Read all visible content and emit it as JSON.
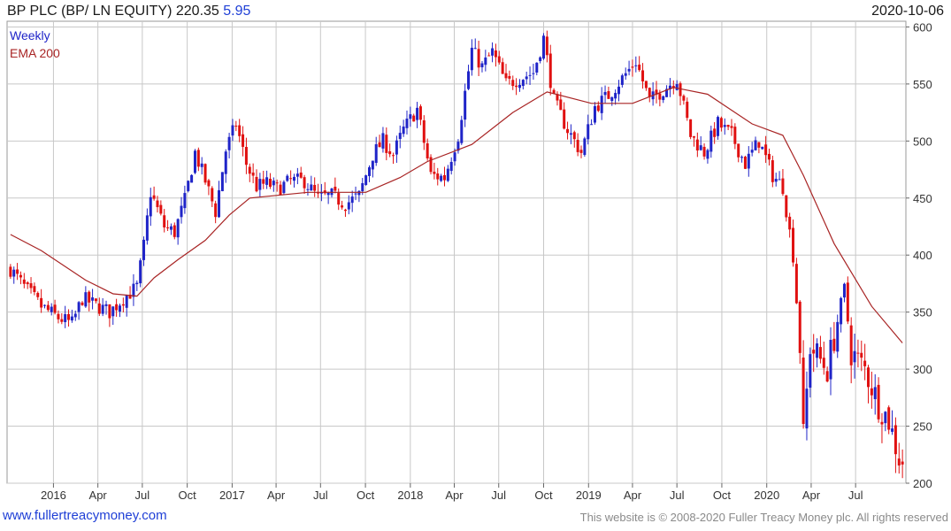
{
  "header": {
    "title": "BP PLC (BP/ LN EQUITY) 220.35",
    "change": "5.95",
    "date": "2020-10-06"
  },
  "footer": {
    "link": "www.fullertreacymoney.com",
    "copyright": "This website is © 2008-2020 Fuller Treacy Money plc. All rights reserved"
  },
  "colors": {
    "up": "#1f24c8",
    "down": "#e01010",
    "ema": "#a82424",
    "grid": "#c8c8c8"
  },
  "chart_data": {
    "type": "candlestick",
    "period": "Weekly",
    "legend": [
      {
        "label": "Weekly",
        "color": "#1f24c8"
      },
      {
        "label": "EMA 200",
        "color": "#a82424"
      }
    ],
    "ylim": [
      200,
      605
    ],
    "y_ticks": [
      200,
      250,
      300,
      350,
      400,
      450,
      500,
      550,
      600
    ],
    "x_ticks": [
      {
        "label": "2016",
        "date": "2016-01-01"
      },
      {
        "label": "Apr",
        "date": "2016-04-01"
      },
      {
        "label": "Jul",
        "date": "2016-07-01"
      },
      {
        "label": "Oct",
        "date": "2016-10-01"
      },
      {
        "label": "2017",
        "date": "2017-01-01"
      },
      {
        "label": "Apr",
        "date": "2017-04-01"
      },
      {
        "label": "Jul",
        "date": "2017-07-01"
      },
      {
        "label": "Oct",
        "date": "2017-10-01"
      },
      {
        "label": "2018",
        "date": "2018-01-01"
      },
      {
        "label": "Apr",
        "date": "2018-04-01"
      },
      {
        "label": "Jul",
        "date": "2018-07-01"
      },
      {
        "label": "Oct",
        "date": "2018-10-01"
      },
      {
        "label": "2019",
        "date": "2019-01-01"
      },
      {
        "label": "Apr",
        "date": "2019-04-01"
      },
      {
        "label": "Jul",
        "date": "2019-07-01"
      },
      {
        "label": "Oct",
        "date": "2019-10-01"
      },
      {
        "label": "2020",
        "date": "2020-01-01"
      },
      {
        "label": "Apr",
        "date": "2020-04-01"
      },
      {
        "label": "Jul",
        "date": "2020-07-01"
      }
    ],
    "x_range": [
      "2015-09-28",
      "2020-10-12"
    ],
    "grid": true,
    "price_path": [
      [
        "2015-10-05",
        388
      ],
      [
        "2015-11-02",
        372
      ],
      [
        "2015-12-07",
        355
      ],
      [
        "2016-01-11",
        345
      ],
      [
        "2016-02-08",
        340
      ],
      [
        "2016-02-29",
        362
      ],
      [
        "2016-03-28",
        356
      ],
      [
        "2016-04-25",
        350
      ],
      [
        "2016-05-23",
        362
      ],
      [
        "2016-06-20",
        372
      ],
      [
        "2016-07-04",
        408
      ],
      [
        "2016-07-18",
        455
      ],
      [
        "2016-08-15",
        425
      ],
      [
        "2016-09-05",
        420
      ],
      [
        "2016-09-26",
        448
      ],
      [
        "2016-10-17",
        490
      ],
      [
        "2016-11-07",
        465
      ],
      [
        "2016-11-28",
        438
      ],
      [
        "2016-12-19",
        492
      ],
      [
        "2017-01-09",
        515
      ],
      [
        "2017-01-30",
        480
      ],
      [
        "2017-02-20",
        460
      ],
      [
        "2017-03-13",
        463
      ],
      [
        "2017-04-03",
        458
      ],
      [
        "2017-05-01",
        465
      ],
      [
        "2017-05-29",
        465
      ],
      [
        "2017-06-26",
        450
      ],
      [
        "2017-07-24",
        452
      ],
      [
        "2017-08-21",
        445
      ],
      [
        "2017-09-18",
        452
      ],
      [
        "2017-10-16",
        488
      ],
      [
        "2017-11-06",
        500
      ],
      [
        "2017-11-27",
        488
      ],
      [
        "2017-12-18",
        510
      ],
      [
        "2018-01-15",
        528
      ],
      [
        "2018-02-12",
        470
      ],
      [
        "2018-03-12",
        468
      ],
      [
        "2018-04-09",
        505
      ],
      [
        "2018-05-07",
        580
      ],
      [
        "2018-05-28",
        565
      ],
      [
        "2018-06-18",
        578
      ],
      [
        "2018-07-16",
        550
      ],
      [
        "2018-08-13",
        555
      ],
      [
        "2018-09-10",
        560
      ],
      [
        "2018-10-01",
        590
      ],
      [
        "2018-10-22",
        535
      ],
      [
        "2018-11-19",
        510
      ],
      [
        "2018-12-17",
        490
      ],
      [
        "2019-01-14",
        530
      ],
      [
        "2019-02-11",
        540
      ],
      [
        "2019-03-11",
        555
      ],
      [
        "2019-04-08",
        570
      ],
      [
        "2019-05-06",
        535
      ],
      [
        "2019-06-03",
        545
      ],
      [
        "2019-07-01",
        555
      ],
      [
        "2019-07-29",
        505
      ],
      [
        "2019-08-26",
        490
      ],
      [
        "2019-09-23",
        515
      ],
      [
        "2019-10-21",
        505
      ],
      [
        "2019-11-18",
        480
      ],
      [
        "2019-12-16",
        500
      ],
      [
        "2020-01-13",
        470
      ],
      [
        "2020-02-03",
        460
      ],
      [
        "2020-02-24",
        400
      ],
      [
        "2020-03-09",
        320
      ],
      [
        "2020-03-16",
        240
      ],
      [
        "2020-03-30",
        320
      ],
      [
        "2020-05-04",
        300
      ],
      [
        "2020-06-08",
        370
      ],
      [
        "2020-06-22",
        315
      ],
      [
        "2020-07-20",
        300
      ],
      [
        "2020-08-17",
        270
      ],
      [
        "2020-09-07",
        255
      ],
      [
        "2020-09-28",
        222
      ],
      [
        "2020-10-05",
        220
      ]
    ],
    "ema_200": [
      [
        "2015-10-05",
        418
      ],
      [
        "2015-12-07",
        404
      ],
      [
        "2016-03-07",
        378
      ],
      [
        "2016-05-02",
        366
      ],
      [
        "2016-06-20",
        364
      ],
      [
        "2016-07-25",
        380
      ],
      [
        "2016-09-12",
        396
      ],
      [
        "2016-11-07",
        413
      ],
      [
        "2016-12-26",
        435
      ],
      [
        "2017-02-06",
        450
      ],
      [
        "2017-06-05",
        455
      ],
      [
        "2017-10-02",
        455
      ],
      [
        "2017-12-11",
        468
      ],
      [
        "2018-02-05",
        482
      ],
      [
        "2018-05-07",
        497
      ],
      [
        "2018-07-30",
        525
      ],
      [
        "2018-10-08",
        543
      ],
      [
        "2019-01-07",
        533
      ],
      [
        "2019-04-01",
        533
      ],
      [
        "2019-06-24",
        547
      ],
      [
        "2019-09-02",
        541
      ],
      [
        "2019-12-02",
        515
      ],
      [
        "2020-02-03",
        505
      ],
      [
        "2020-03-16",
        470
      ],
      [
        "2020-05-18",
        410
      ],
      [
        "2020-08-03",
        355
      ],
      [
        "2020-10-05",
        323
      ]
    ]
  }
}
